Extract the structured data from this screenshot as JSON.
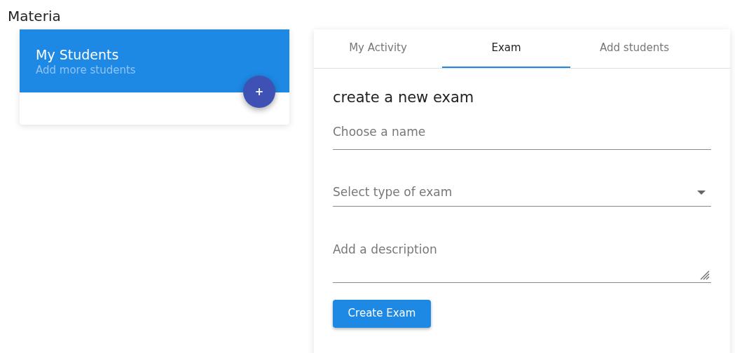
{
  "page_title": "Materia",
  "students_card": {
    "title": "My Students",
    "subtitle": "Add more students",
    "add_button": "+"
  },
  "tabs": [
    {
      "label": "My Activity",
      "selected": false
    },
    {
      "label": "Exam",
      "selected": true
    },
    {
      "label": "Add students",
      "selected": false
    }
  ],
  "exam_form": {
    "heading": "create a new exam",
    "fields": [
      {
        "kind": "text",
        "placeholder": "Choose a name"
      },
      {
        "kind": "select",
        "placeholder": "Select type of exam"
      },
      {
        "kind": "textarea",
        "placeholder": "Add a description"
      }
    ],
    "submit": "Create Exam"
  }
}
